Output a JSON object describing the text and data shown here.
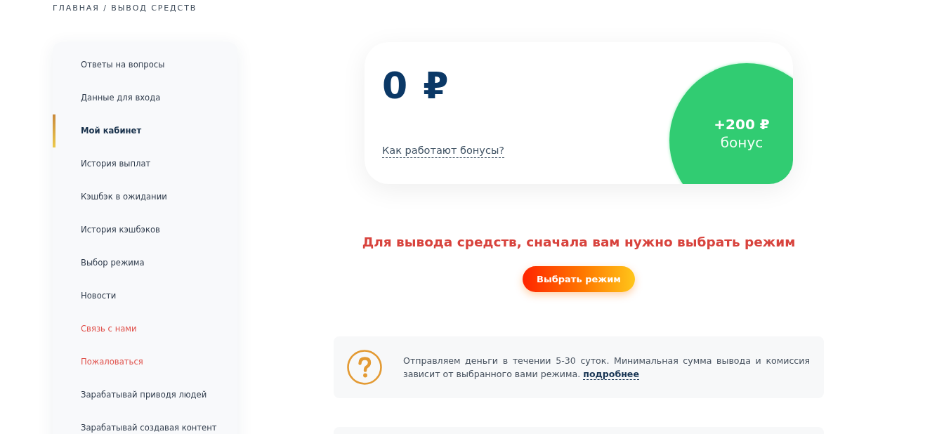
{
  "breadcrumb": "ГЛАВНАЯ / ВЫВОД СРЕДСТВ",
  "sidebar": {
    "items": [
      {
        "label": "Ответы на вопросы",
        "selected": false,
        "kind": "normal"
      },
      {
        "label": "Данные для входа",
        "selected": false,
        "kind": "normal"
      },
      {
        "label": "Мой кабинет",
        "selected": true,
        "kind": "normal"
      },
      {
        "label": "История выплат",
        "selected": false,
        "kind": "normal"
      },
      {
        "label": "Кэшбэк в ожидании",
        "selected": false,
        "kind": "normal"
      },
      {
        "label": "История кэшбэков",
        "selected": false,
        "kind": "normal"
      },
      {
        "label": "Выбор режима",
        "selected": false,
        "kind": "normal"
      },
      {
        "label": "Новости",
        "selected": false,
        "kind": "normal"
      },
      {
        "label": "Связь с нами",
        "selected": false,
        "kind": "accent"
      },
      {
        "label": "Пожаловаться",
        "selected": false,
        "kind": "accent"
      },
      {
        "label": "Зарабатывай приводя людей",
        "selected": false,
        "kind": "normal"
      },
      {
        "label": "Зарабатывай создавая контент",
        "selected": false,
        "kind": "normal"
      }
    ]
  },
  "balance": {
    "amount": "0 ₽",
    "link": "Как работают бонусы?",
    "bonus": {
      "amount": "+200 ₽",
      "label": "бонус"
    }
  },
  "notice": {
    "message": "Для вывода средств, сначала вам нужно выбрать режим",
    "button": "Выбрать режим"
  },
  "info": {
    "text": "Отправляем деньги в течении 5-30 суток. Минимальная сумма вывода и комиссия зависит от выбранного вами режима.",
    "link": "подробнее"
  }
}
